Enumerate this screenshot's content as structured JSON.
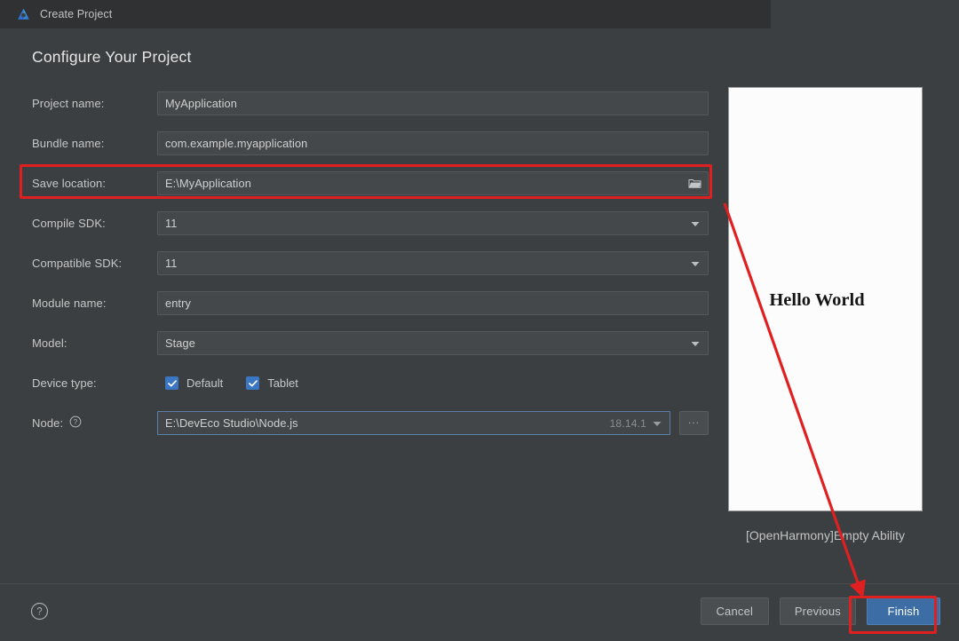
{
  "window": {
    "title": "Create Project",
    "logo_icon": "deveco-studio-logo",
    "close_icon": "close-icon"
  },
  "page": {
    "heading": "Configure Your Project"
  },
  "form": {
    "fields": [
      {
        "label": "Project name:",
        "value": "MyApplication",
        "type": "text"
      },
      {
        "label": "Bundle name:",
        "value": "com.example.myapplication",
        "type": "text"
      },
      {
        "label": "Save location:",
        "value": "E:\\MyApplication",
        "type": "text-browse",
        "browse_icon": "folder-icon"
      },
      {
        "label": "Compile SDK:",
        "value": "11",
        "type": "combo",
        "chevron_icon": "chevron-down-icon"
      },
      {
        "label": "Compatible SDK:",
        "value": "11",
        "type": "combo",
        "chevron_icon": "chevron-down-icon"
      },
      {
        "label": "Module name:",
        "value": "entry",
        "type": "text"
      },
      {
        "label": "Model:",
        "value": "Stage",
        "type": "combo",
        "chevron_icon": "chevron-down-icon"
      }
    ],
    "device_type": {
      "label": "Device type:",
      "options": [
        {
          "label": "Default",
          "checked": true
        },
        {
          "label": "Tablet",
          "checked": true
        }
      ]
    },
    "node": {
      "label": "Node:",
      "help_icon": "question-circle-icon",
      "value": "E:\\DevEco Studio\\Node.js",
      "version": "18.14.1",
      "chevron_icon": "chevron-down-icon",
      "browse_label": "...",
      "browse_name": "ellipsis-browse-button"
    }
  },
  "preview": {
    "phone_text": "Hello World",
    "caption": "[OpenHarmony]Empty Ability"
  },
  "footer": {
    "help_icon": "question-circle-icon",
    "cancel_label": "Cancel",
    "previous_label": "Previous",
    "finish_label": "Finish"
  },
  "annotations": {
    "accent_color": "#e02020",
    "highlight_save_location": "Save location field highlighted",
    "highlight_finish": "Finish button highlighted",
    "arrow": "arrow pointing from Save location to Finish"
  },
  "colors": {
    "dialog_bg": "#3c3f41",
    "titlebar_bg": "#2f3133",
    "field_bg": "#45484a",
    "primary_button": "#3c6ea5",
    "checkbox": "#3b76c4",
    "annotation_red": "#e02020"
  }
}
